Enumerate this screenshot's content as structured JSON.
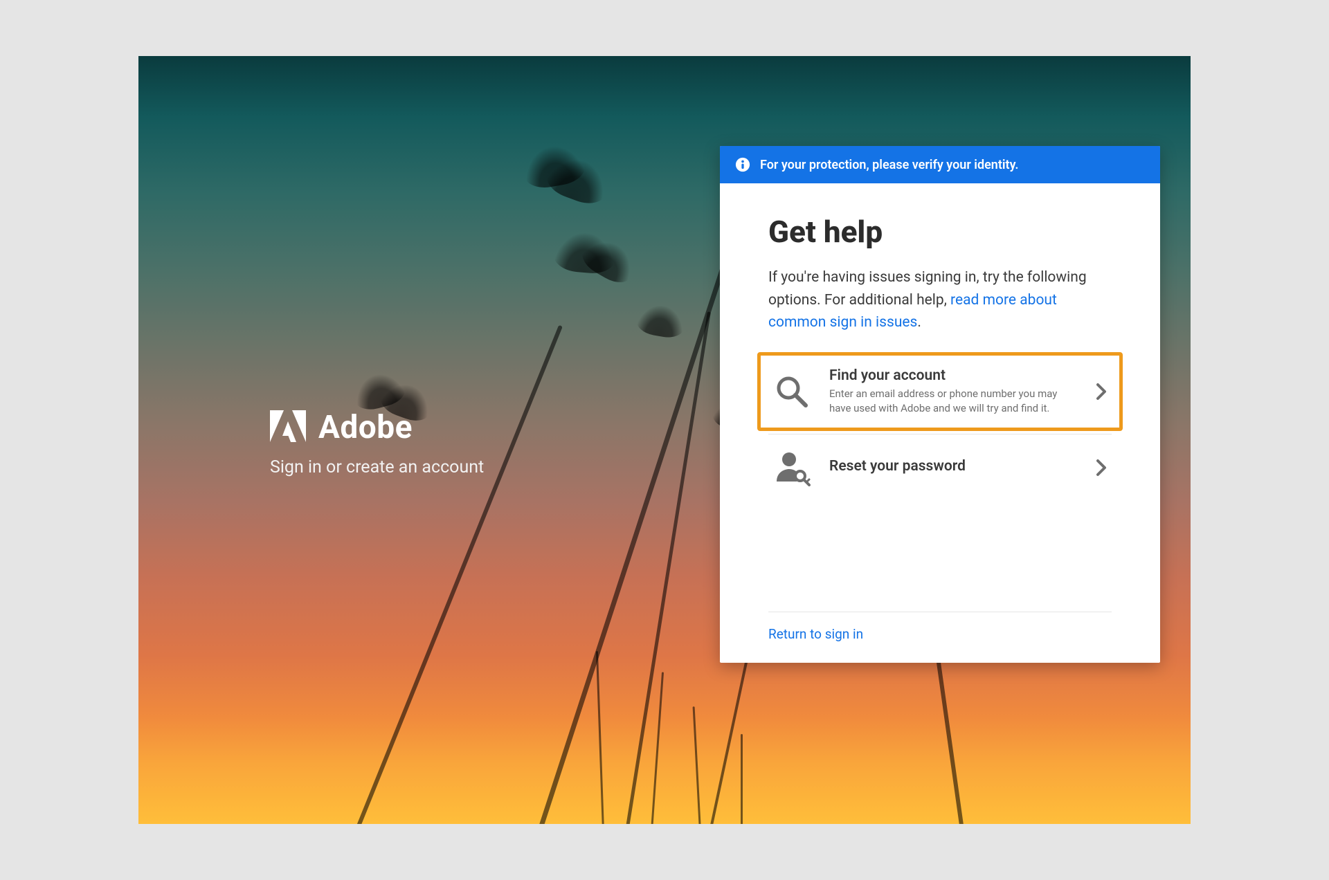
{
  "brand": {
    "name": "Adobe",
    "subtitle": "Sign in or create an account"
  },
  "banner": {
    "text": "For your protection, please verify your identity."
  },
  "panel": {
    "title": "Get help",
    "desc_before": "If you're having issues signing in, try the following options. For additional help, ",
    "desc_link": "read more about common sign in issues",
    "desc_after": "."
  },
  "options": {
    "find": {
      "title": "Find your account",
      "sub": "Enter an email address or phone number you may have used with Adobe and we will try and find it."
    },
    "reset": {
      "title": "Reset your password"
    }
  },
  "footer": {
    "return": "Return to sign in"
  }
}
